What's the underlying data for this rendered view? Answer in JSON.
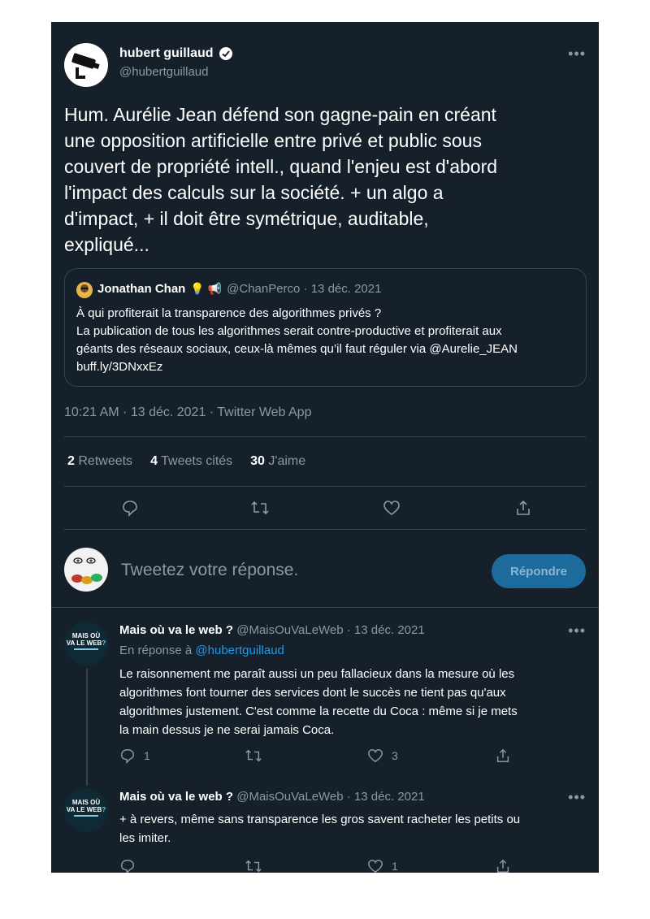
{
  "main_tweet": {
    "author_name": "hubert guillaud",
    "author_handle": "@hubertguillaud",
    "text_lines": [
      "Hum. Aurélie Jean défend son gagne-pain en créant",
      "une opposition artificielle entre privé et public sous",
      "couvert de propriété intell., quand l'enjeu est d'abord",
      "l'impact des calculs sur la société. + un algo a",
      "d'impact, + il doit être symétrique, auditable,",
      "expliqué..."
    ],
    "quoted": {
      "name": "Jonathan Chan",
      "emoji": "💡 📢",
      "handle_date": "@ChanPerco · 13 déc. 2021",
      "lines": [
        "À qui profiterait la transparence des algorithmes privés ?",
        "La publication de tous les algorithmes serait contre-productive et profiterait aux",
        "géants des réseaux sociaux, ceux-là mêmes qu’il faut réguler via @Aurelie_JEAN",
        "buff.ly/3DNxxEz"
      ]
    },
    "meta": "10:21 AM · 13 déc. 2021 · Twitter Web App",
    "stats": {
      "retweets_count": "2",
      "retweets_label": "Retweets",
      "quotes_count": "4",
      "quotes_label": "Tweets cités",
      "likes_count": "30",
      "likes_label": "J'aime"
    }
  },
  "reply_box": {
    "placeholder": "Tweetez votre réponse.",
    "button_label": "Répondre"
  },
  "replies": [
    {
      "author_name": "Mais où va le web ?",
      "handle_date": "@MaisOuVaLeWeb · 13 déc. 2021",
      "in_reply_prefix": "En réponse à",
      "in_reply_handle": "@hubertguillaud",
      "lines": [
        "Le raisonnement me paraît aussi un peu fallacieux dans la mesure où les",
        "algorithmes font tourner des services dont le succès ne tient pas qu'aux",
        "algorithmes justement. C'est comme la recette du Coca : même si je mets",
        "la main dessus je ne serai jamais Coca."
      ],
      "reply_count": "1",
      "like_count": "3"
    },
    {
      "author_name": "Mais où va le web ?",
      "handle_date": "@MaisOuVaLeWeb · 13 déc. 2021",
      "lines": [
        "+ à revers, même sans transparence les gros savent racheter les petits ou",
        "les imiter."
      ],
      "like_count": "1"
    }
  ],
  "avatar_text": {
    "line1": "MAIS OÙ",
    "line2": "VA LE WEB",
    "mark": "?"
  },
  "colors": {
    "background": "#15202b",
    "accent": "#1d9bf0",
    "muted": "#8b98a5",
    "divider": "#38444d"
  }
}
